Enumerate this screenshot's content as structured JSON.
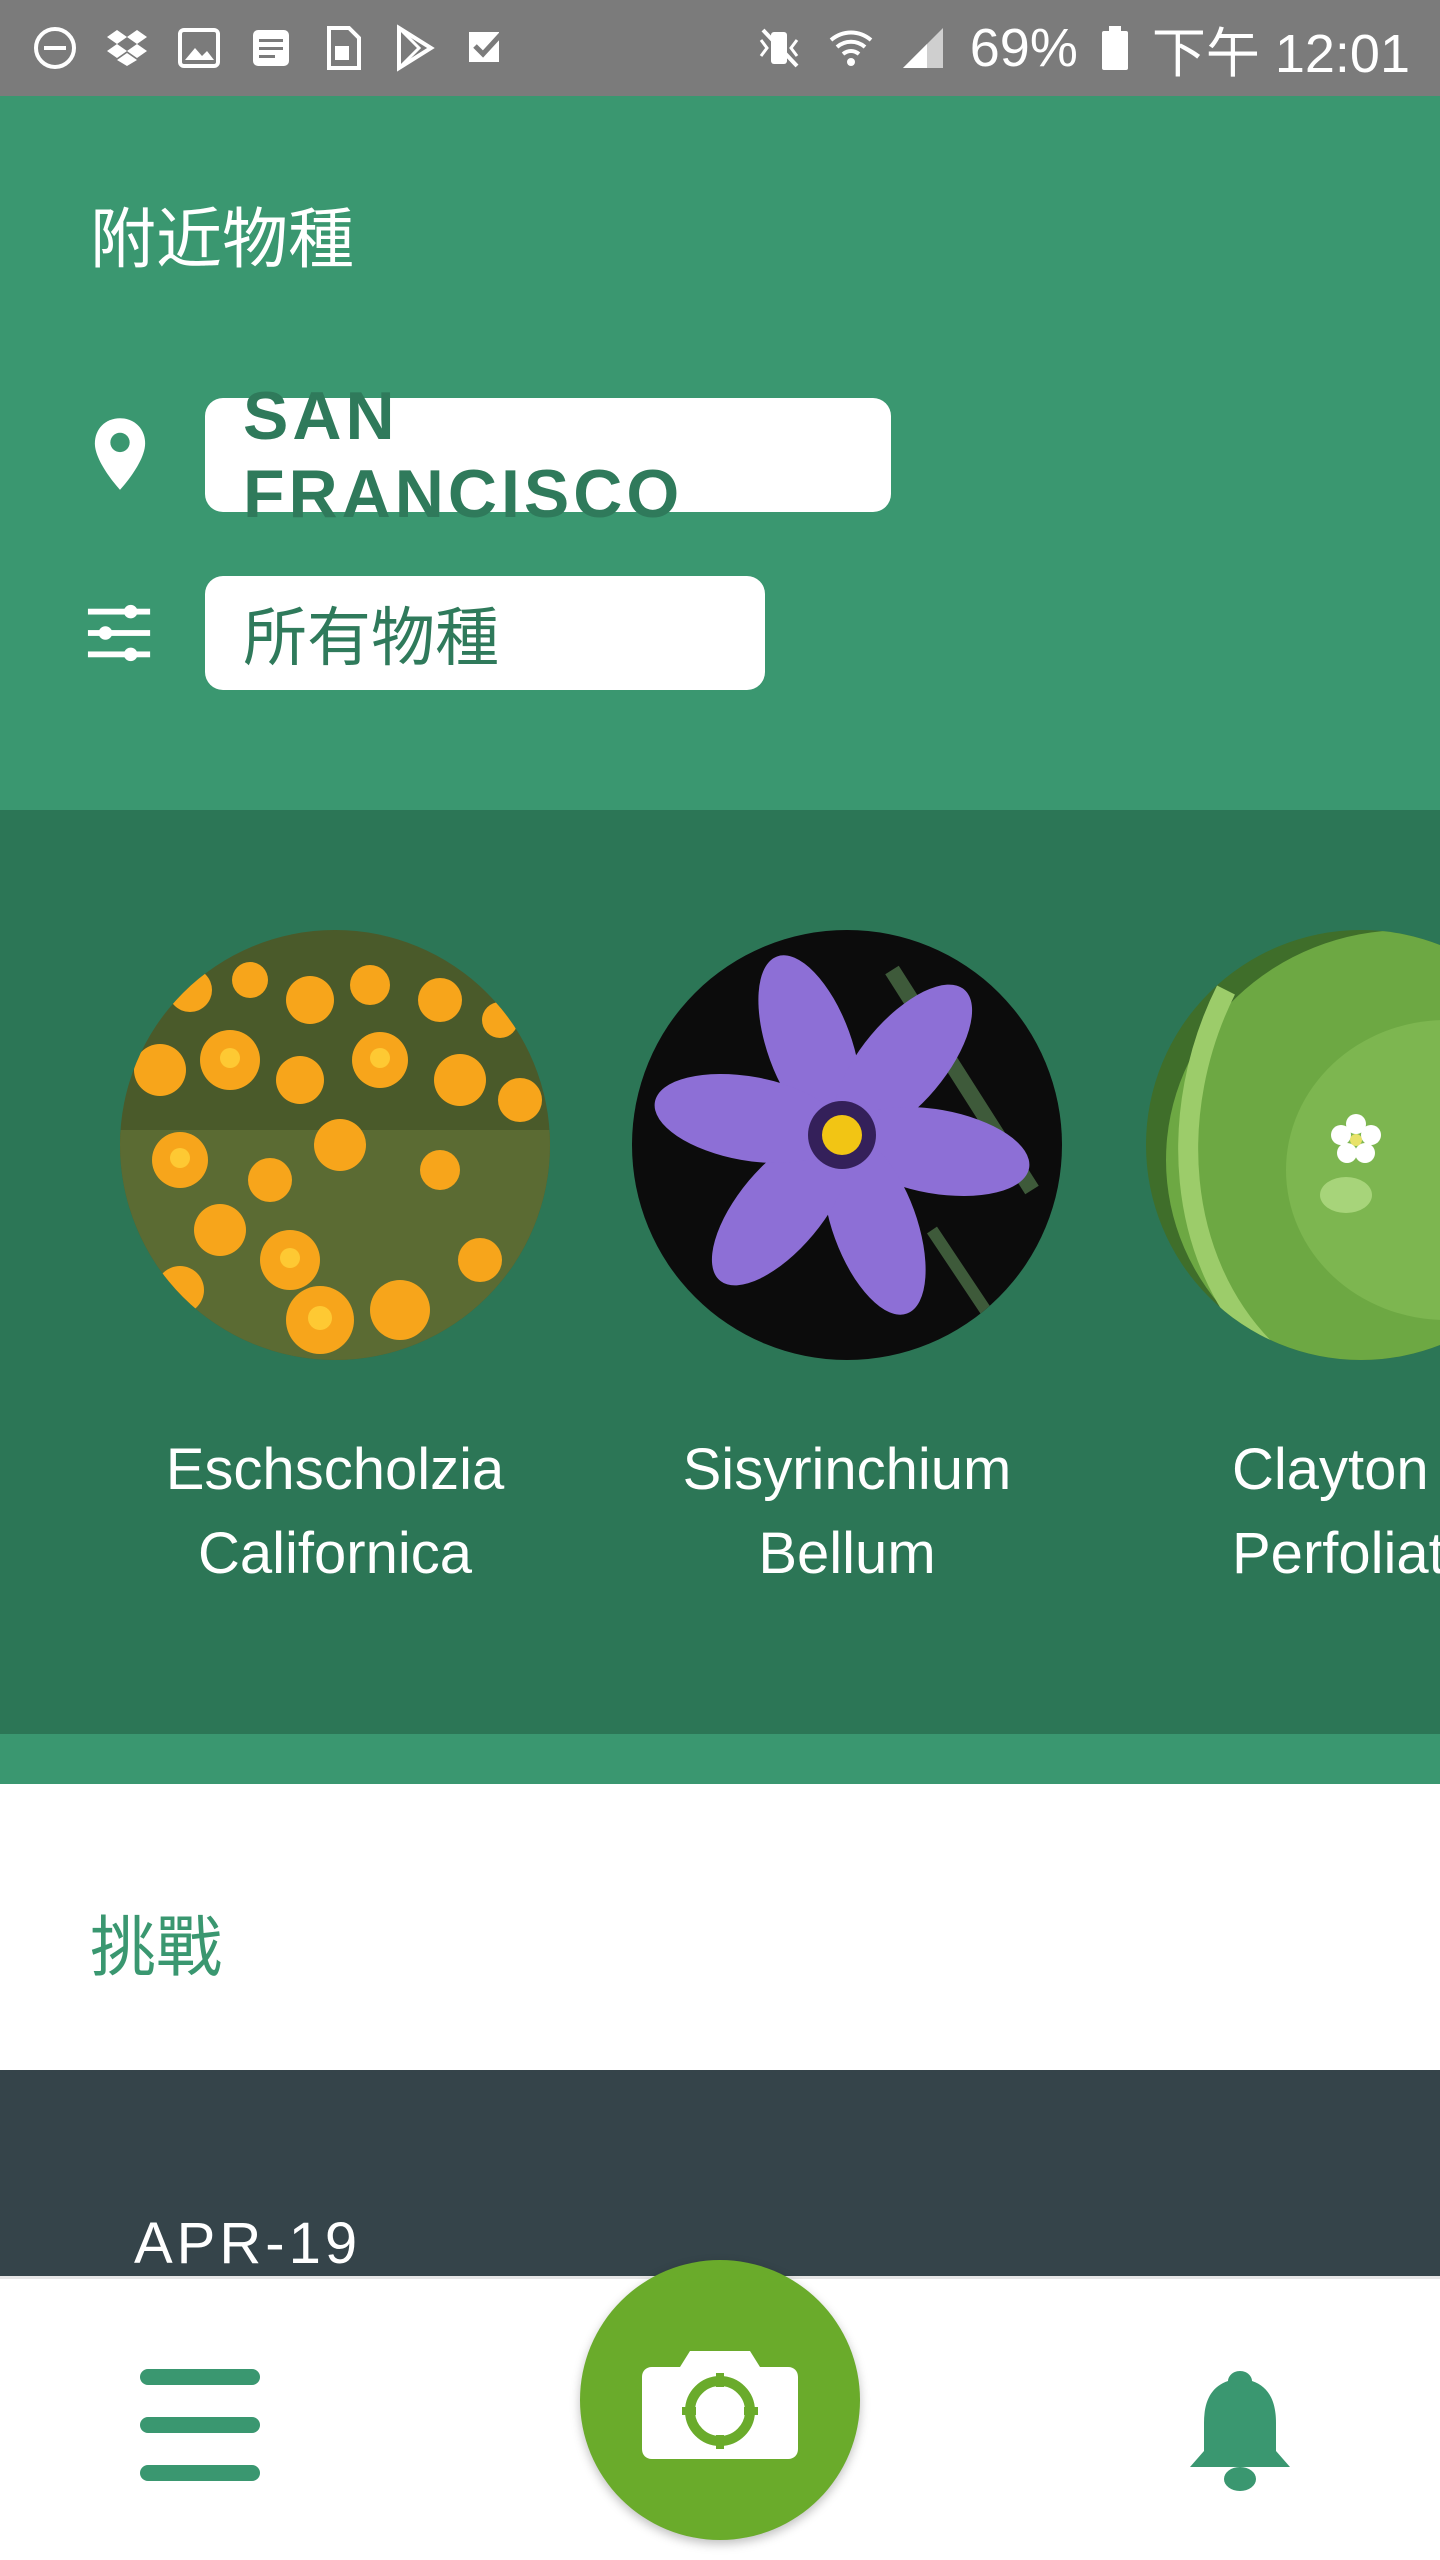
{
  "status_bar": {
    "battery_percent": "69%",
    "time": "下午 12:01",
    "left_icons": [
      "do-not-disturb-icon",
      "dropbox-icon",
      "image-icon",
      "notes-icon",
      "sim-icon",
      "play-store-icon",
      "check-icon"
    ],
    "right_icons": [
      "mute-icon",
      "wifi-icon",
      "signal-icon",
      "battery-icon"
    ]
  },
  "header": {
    "title": "附近物種",
    "location_label": "SAN FRANCISCO",
    "species_filter_label": "所有物種"
  },
  "species": [
    {
      "name_line1": "Eschscholzia",
      "name_line2": "Californica"
    },
    {
      "name_line1": "Sisyrinchium",
      "name_line2": "Bellum"
    },
    {
      "name_line1": "Clayton",
      "name_line2": "Perfoliat"
    }
  ],
  "challenges": {
    "title": "挑戰",
    "card_date": "APR-19"
  },
  "colors": {
    "header_green": "#3a9770",
    "strip_dark_green": "#2c7656",
    "camera_green": "#6aab2b",
    "challenge_card": "#35444a"
  }
}
